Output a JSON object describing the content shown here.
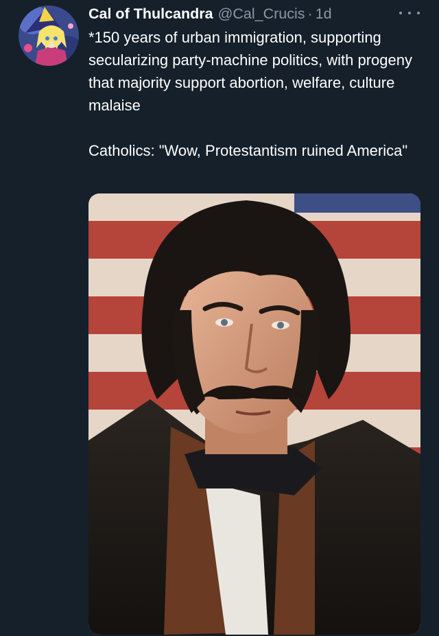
{
  "tweet": {
    "display_name": "Cal of Thulcandra",
    "handle": "@Cal_Crucis",
    "separator": "·",
    "time": "1d",
    "paragraph_1": "*150 years of urban immigration, supporting secularizing party-machine politics, with progeny that majority support abortion, welfare, culture malaise",
    "paragraph_2": "Catholics: \"Wow, Protestantism ruined America\""
  },
  "colors": {
    "background": "#15202b",
    "secondary_text": "#8b98a5",
    "primary_text": "#ffffff"
  },
  "icons": {
    "more": "more-horizontal-icon",
    "avatar": "anime-avatar"
  }
}
